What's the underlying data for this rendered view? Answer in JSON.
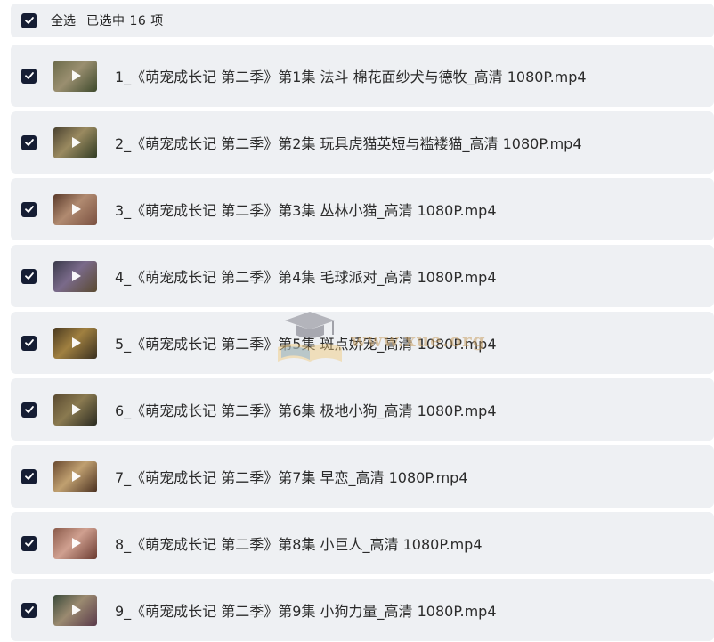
{
  "header": {
    "select_all_label": "全选",
    "selected_summary": "已选中  16  项"
  },
  "files": [
    {
      "name": "1_《萌宠成长记 第二季》第1集 法斗 棉花面纱犬与德牧_高清 1080P.mp4",
      "thumb_colors": [
        "#6b6a4a",
        "#9a8f70",
        "#3e4a2c"
      ]
    },
    {
      "name": "2_《萌宠成长记 第二季》第2集 玩具虎猫英短与褴褛猫_高清 1080P.mp4",
      "thumb_colors": [
        "#4a4230",
        "#9a8a60",
        "#2f3a22"
      ]
    },
    {
      "name": "3_《萌宠成长记 第二季》第3集 丛林小猫_高清 1080P.mp4",
      "thumb_colors": [
        "#5a3a2a",
        "#b08a70",
        "#7a5040"
      ]
    },
    {
      "name": "4_《萌宠成长记 第二季》第4集 毛球派对_高清 1080P.mp4",
      "thumb_colors": [
        "#3a3a4a",
        "#7a6a8a",
        "#5a4a30"
      ]
    },
    {
      "name": "5_《萌宠成长记 第二季》第5集 斑点娇宠_高清 1080P.mp4",
      "thumb_colors": [
        "#4a3a20",
        "#a08040",
        "#3a3020"
      ]
    },
    {
      "name": "6_《萌宠成长记 第二季》第6集 极地小狗_高清 1080P.mp4",
      "thumb_colors": [
        "#5a4a30",
        "#8a7a50",
        "#2a2a20"
      ]
    },
    {
      "name": "7_《萌宠成长记 第二季》第7集 早恋_高清 1080P.mp4",
      "thumb_colors": [
        "#6a4a30",
        "#c0a070",
        "#4a3020"
      ]
    },
    {
      "name": "8_《萌宠成长记 第二季》第8集 小巨人_高清 1080P.mp4",
      "thumb_colors": [
        "#8a5a4a",
        "#d0a090",
        "#6a3a30"
      ]
    },
    {
      "name": "9_《萌宠成长记 第二季》第9集 小狗力量_高清 1080P.mp4",
      "thumb_colors": [
        "#3a4a3a",
        "#9a8a70",
        "#5a3a4a"
      ]
    }
  ],
  "watermark": {
    "text": "www.xue.org",
    "icon": "graduation-cap-book-icon"
  },
  "colors": {
    "checkbox": "#151d33",
    "row_background": "#eef0f3"
  }
}
